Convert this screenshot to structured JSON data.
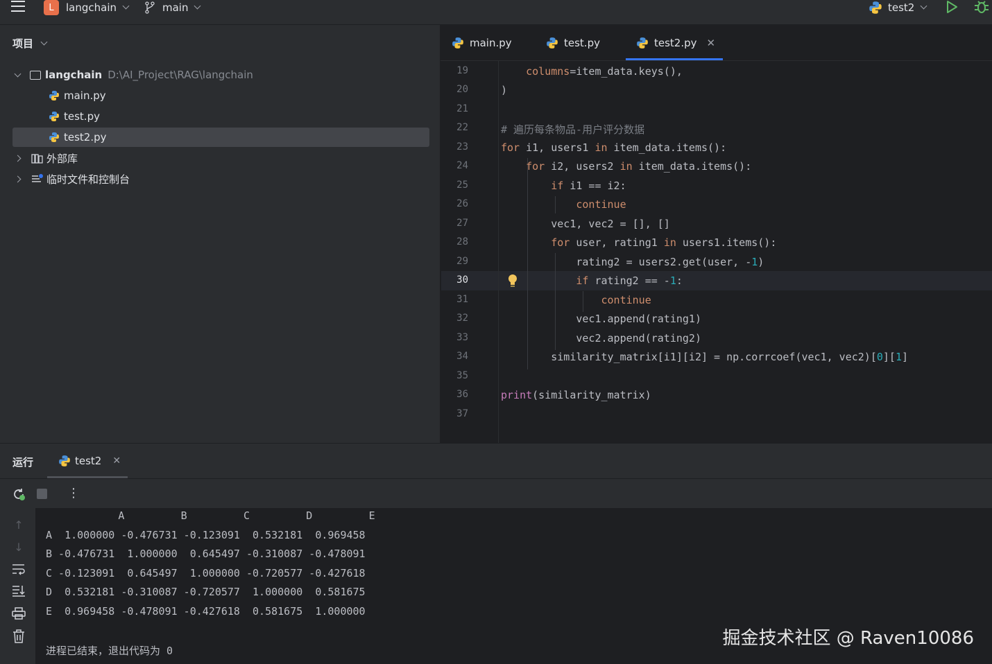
{
  "topbar": {
    "project_badge": "L",
    "project_name": "langchain",
    "branch": "main",
    "run_config": "test2"
  },
  "project_panel": {
    "title": "项目",
    "root_name": "langchain",
    "root_path": "D:\\AI_Project\\RAG\\langchain",
    "files": [
      "main.py",
      "test.py",
      "test2.py"
    ],
    "external_libs": "外部库",
    "scratches": "临时文件和控制台"
  },
  "editor": {
    "tabs": [
      "main.py",
      "test.py",
      "test2.py"
    ],
    "active_tab": "test2.py",
    "current_line": "30",
    "line_numbers": [
      "19",
      "20",
      "21",
      "22",
      "23",
      "24",
      "25",
      "26",
      "27",
      "28",
      "29",
      "30",
      "31",
      "32",
      "33",
      "34",
      "35",
      "36",
      "37"
    ]
  },
  "run_panel": {
    "title": "运行",
    "tab": "test2",
    "header_row": "            A         B         C         D         E",
    "rows": [
      "A  1.000000 -0.476731 -0.123091  0.532181  0.969458",
      "B -0.476731  1.000000  0.645497 -0.310087 -0.478091",
      "C -0.123091  0.645497  1.000000 -0.720577 -0.427618",
      "D  0.532181 -0.310087 -0.720577  1.000000  0.581675",
      "E  0.969458 -0.478091 -0.427618  0.581675  1.000000"
    ],
    "exit_message": "进程已结束，退出代码为 0"
  },
  "watermark": "掘金技术社区 @ Raven10086",
  "colors": {
    "accent": "#3574f0",
    "keyword": "#cf8e6d",
    "number": "#2aacb8",
    "comment": "#7a7e85"
  }
}
